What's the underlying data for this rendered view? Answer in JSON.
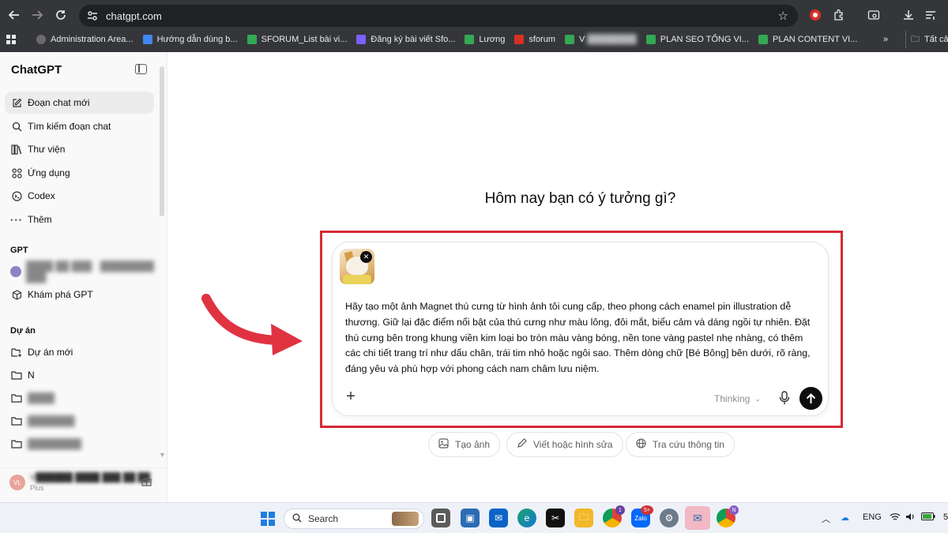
{
  "browser": {
    "url": "chatgpt.com",
    "bookmarks": [
      {
        "label": "Administration Area...",
        "color": "#6b6b6b"
      },
      {
        "label": "Hướng dẫn dùng b...",
        "color": "#4285f4"
      },
      {
        "label": "SFORUM_List bài vi...",
        "color": "#34a853"
      },
      {
        "label": "Đăng ký bài viết Sfo...",
        "color": "#7b61ff"
      },
      {
        "label": "Lương",
        "color": "#34a853"
      },
      {
        "label": "sforum",
        "color": "#d93025"
      },
      {
        "label": "V",
        "color": "#34a853"
      },
      {
        "label": "PLAN SEO TỔNG VI...",
        "color": "#34a853"
      },
      {
        "label": "PLAN CONTENT VI...",
        "color": "#34a853"
      }
    ],
    "bookmarks_overflow": "»",
    "all_bookmarks_label": "Tất cả"
  },
  "sidebar": {
    "brand": "ChatGPT",
    "items": [
      {
        "label": "Đoạn chat mới",
        "icon": "edit-icon"
      },
      {
        "label": "Tìm kiếm đoạn chat",
        "icon": "search-icon"
      },
      {
        "label": "Thư viện",
        "icon": "library-icon"
      },
      {
        "label": "Ứng dụng",
        "icon": "apps-icon"
      },
      {
        "label": "Codex",
        "icon": "codex-icon"
      },
      {
        "label": "Thêm",
        "icon": "more-icon"
      }
    ],
    "gpt_heading": "GPT",
    "gpt_items": [
      {
        "label": "Khám phá GPT",
        "icon": "cube-icon"
      }
    ],
    "projects_heading": "Dự án",
    "projects": [
      {
        "label": "Dự án mới",
        "icon": "folder-plus-icon"
      },
      {
        "label": "N",
        "icon": "folder-icon"
      }
    ],
    "user": {
      "initials": "VL",
      "plan": "Plus"
    }
  },
  "main": {
    "headline": "Hôm nay bạn có ý tưởng gì?",
    "prompt": "Hãy tạo một ảnh Magnet thú cưng từ hình ảnh tôi cung cấp, theo phong cách enamel pin illustration dễ thương. Giữ lại đặc điểm nổi bật của thú cưng như màu lông, đôi mắt, biểu cảm và dáng ngồi tự nhiên. Đặt thú cưng bên trong khung viền kim loại bo tròn màu vàng bóng, nền tone vàng pastel nhẹ nhàng, có thêm các chi tiết trang trí như dấu chân, trái tim nhỏ hoặc ngôi sao. Thêm dòng chữ [Bé Bông] bên dưới, rõ ràng, đáng yêu và phù hợp với phong cách nam châm lưu niệm.",
    "model_selector": "Thinking",
    "chips": [
      {
        "label": "Tạo ảnh",
        "icon": "image-icon"
      },
      {
        "label": "Viết hoặc hình sửa",
        "icon": "pen-icon"
      },
      {
        "label": "Tra cứu thông tin",
        "icon": "globe-icon"
      }
    ]
  },
  "taskbar": {
    "search_label": "Search",
    "language": "ENG",
    "badges": {
      "chrome": "1",
      "zalo": "5+"
    }
  },
  "colors": {
    "highlight": "#d62a35",
    "arrow": "#e03342",
    "sidebar_bg": "#f9f9f9",
    "chrome_bg": "#35363a"
  }
}
